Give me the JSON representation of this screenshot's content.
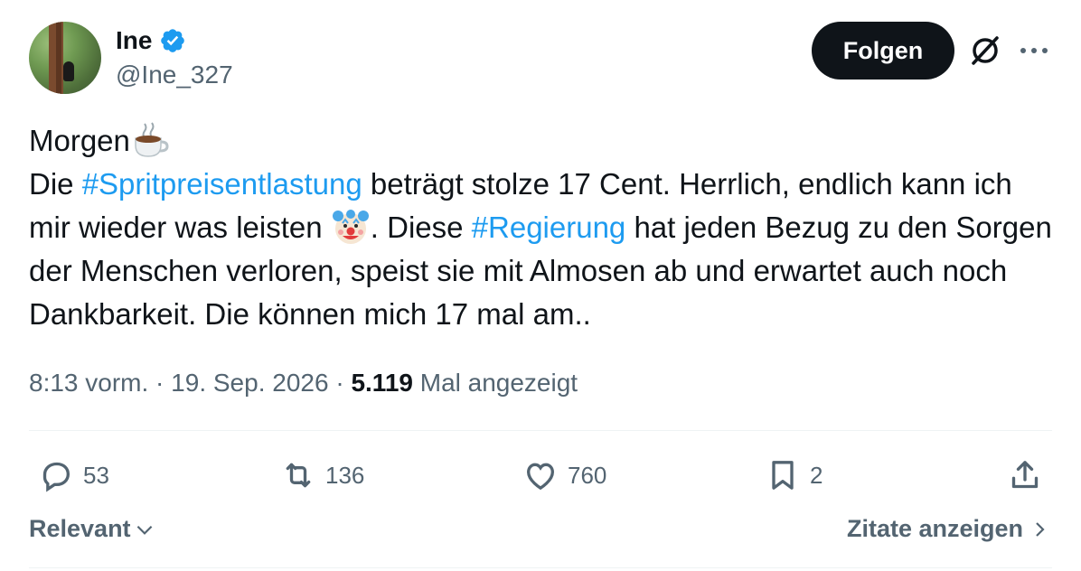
{
  "author": {
    "display_name": "Ine",
    "handle": "@Ine_327",
    "verified": true
  },
  "follow_label": "Folgen",
  "icons": {
    "verified": "verified-badge-icon",
    "grok": "grok-icon",
    "more": "more-options-icon",
    "reply": "reply-icon",
    "repost": "repost-icon",
    "like": "like-icon",
    "bookmark": "bookmark-icon",
    "share": "share-icon",
    "coffee_emoji": "hot-beverage-emoji",
    "clown_emoji": "clown-face-emoji"
  },
  "tweet": {
    "line1": "Morgen",
    "seg1": "Die ",
    "hashtag1": "#Spritpreisentlastung",
    "seg2": " beträgt stolze 17 Cent. Herrlich, endlich kann ich mir wieder was leisten ",
    "seg3": ". Diese ",
    "hashtag2": "#Regierung",
    "seg4": " hat jeden Bezug zu den Sorgen der Menschen verloren, speist sie mit Almosen ab und erwartet auch noch Dankbarkeit. Die können mich 17 mal am.."
  },
  "meta": {
    "time": "8:13 vorm.",
    "sep1": " · ",
    "date": "19. Sep. 2026",
    "sep2": " · ",
    "views_count": "5.119",
    "views_label": " Mal angezeigt"
  },
  "stats": {
    "replies": "53",
    "reposts": "136",
    "likes": "760",
    "bookmarks": "2"
  },
  "footer": {
    "sort_label": "Relevant",
    "quotes_label": "Zitate anzeigen"
  },
  "colors": {
    "accent": "#1d9bf0",
    "text": "#0f1419",
    "secondary": "#536471",
    "button_bg": "#0f1419"
  }
}
